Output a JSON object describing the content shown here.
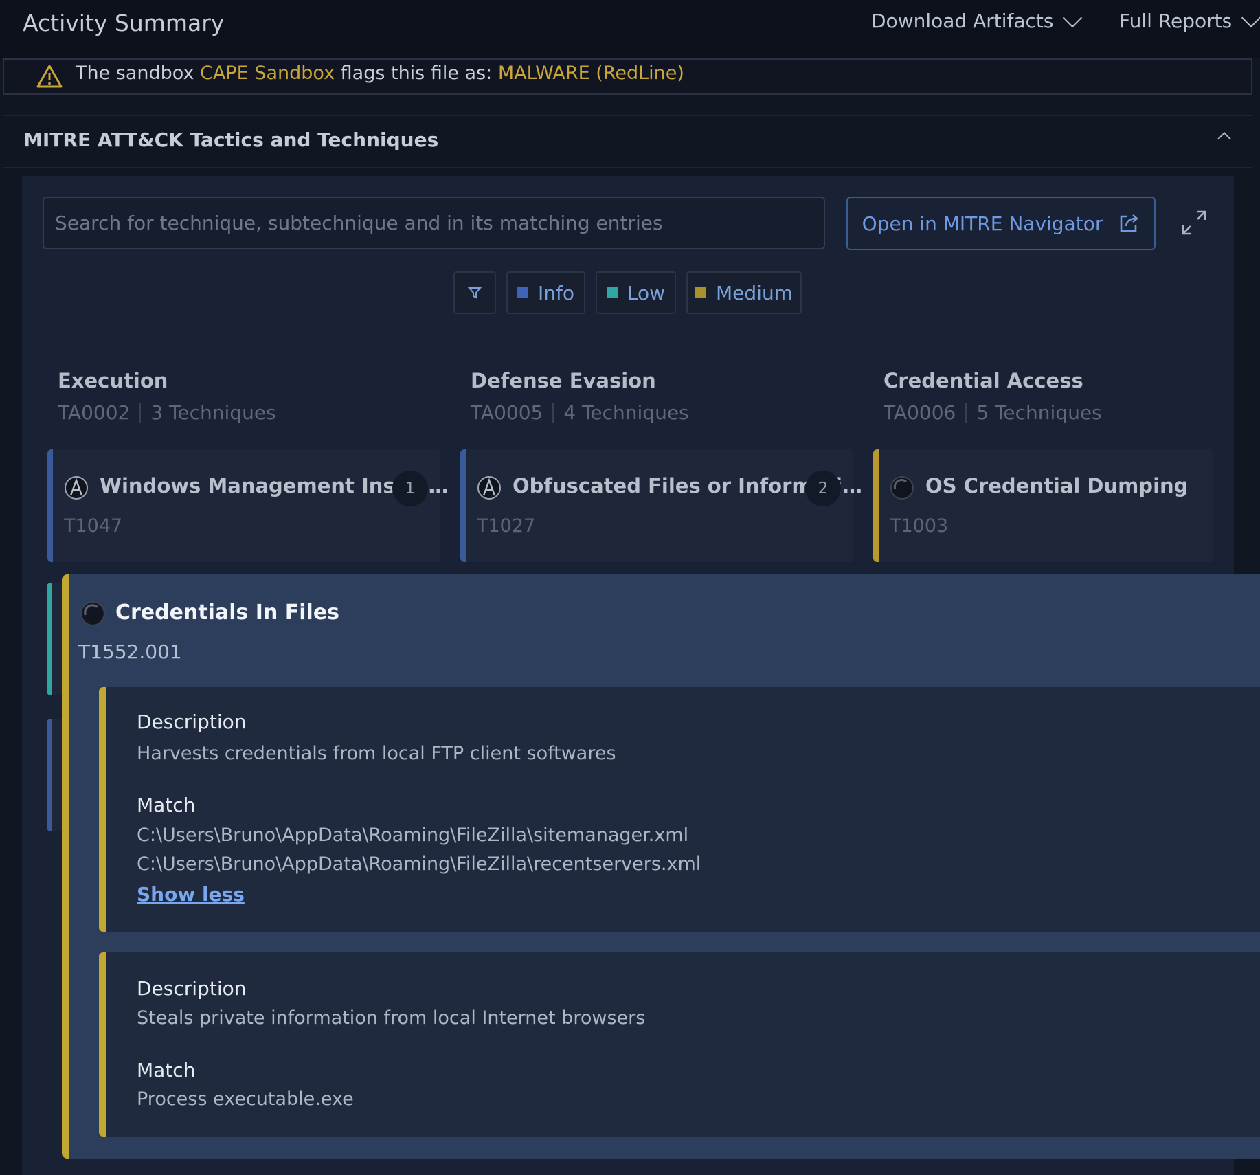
{
  "header": {
    "title": "Activity Summary",
    "download_label": "Download Artifacts",
    "reports_label": "Full Reports"
  },
  "alert": {
    "prefix": "The sandbox ",
    "sandbox": "CAPE Sandbox",
    "middle": " flags this file as: ",
    "verdict": "MALWARE (RedLine)"
  },
  "section": {
    "title": "MITRE ATT&CK Tactics and Techniques"
  },
  "search": {
    "placeholder": "Search for technique, subtechnique and in its matching entries"
  },
  "navigator": {
    "label": "Open in MITRE Navigator"
  },
  "filters": {
    "items": [
      {
        "label": "Info",
        "color": "#3f63b8"
      },
      {
        "label": "Low",
        "color": "#2fa6a0"
      },
      {
        "label": "Medium",
        "color": "#a8902c"
      }
    ]
  },
  "tactics": [
    {
      "name": "Execution",
      "id": "TA0002",
      "count": "3 Techniques",
      "technique": {
        "name": "Windows Management Instru…",
        "id": "T1047",
        "badge": "1",
        "bar_color": "#3a5a99"
      }
    },
    {
      "name": "Defense Evasion",
      "id": "TA0005",
      "count": "4 Techniques",
      "technique": {
        "name": "Obfuscated Files or Informati…",
        "id": "T1027",
        "badge": "2",
        "bar_color": "#3a5a99"
      }
    },
    {
      "name": "Credential Access",
      "id": "TA0006",
      "count": "5 Techniques",
      "technique": {
        "name": "OS Credential Dumping",
        "id": "T1003",
        "badge": "",
        "bar_color": "#b89b2c"
      }
    }
  ],
  "expanded": {
    "title": "Credentials In Files",
    "id": "T1552.001",
    "entries": [
      {
        "desc_label": "Description",
        "description": "Harvests credentials from local FTP client softwares",
        "match_label": "Match",
        "matches": [
          "C:\\Users\\Bruno\\AppData\\Roaming\\FileZilla\\sitemanager.xml",
          "C:\\Users\\Bruno\\AppData\\Roaming\\FileZilla\\recentservers.xml"
        ],
        "toggle": "Show less"
      },
      {
        "desc_label": "Description",
        "description": "Steals private information from local Internet browsers",
        "match_label": "Match",
        "matches": [
          "Process executable.exe"
        ]
      }
    ]
  }
}
